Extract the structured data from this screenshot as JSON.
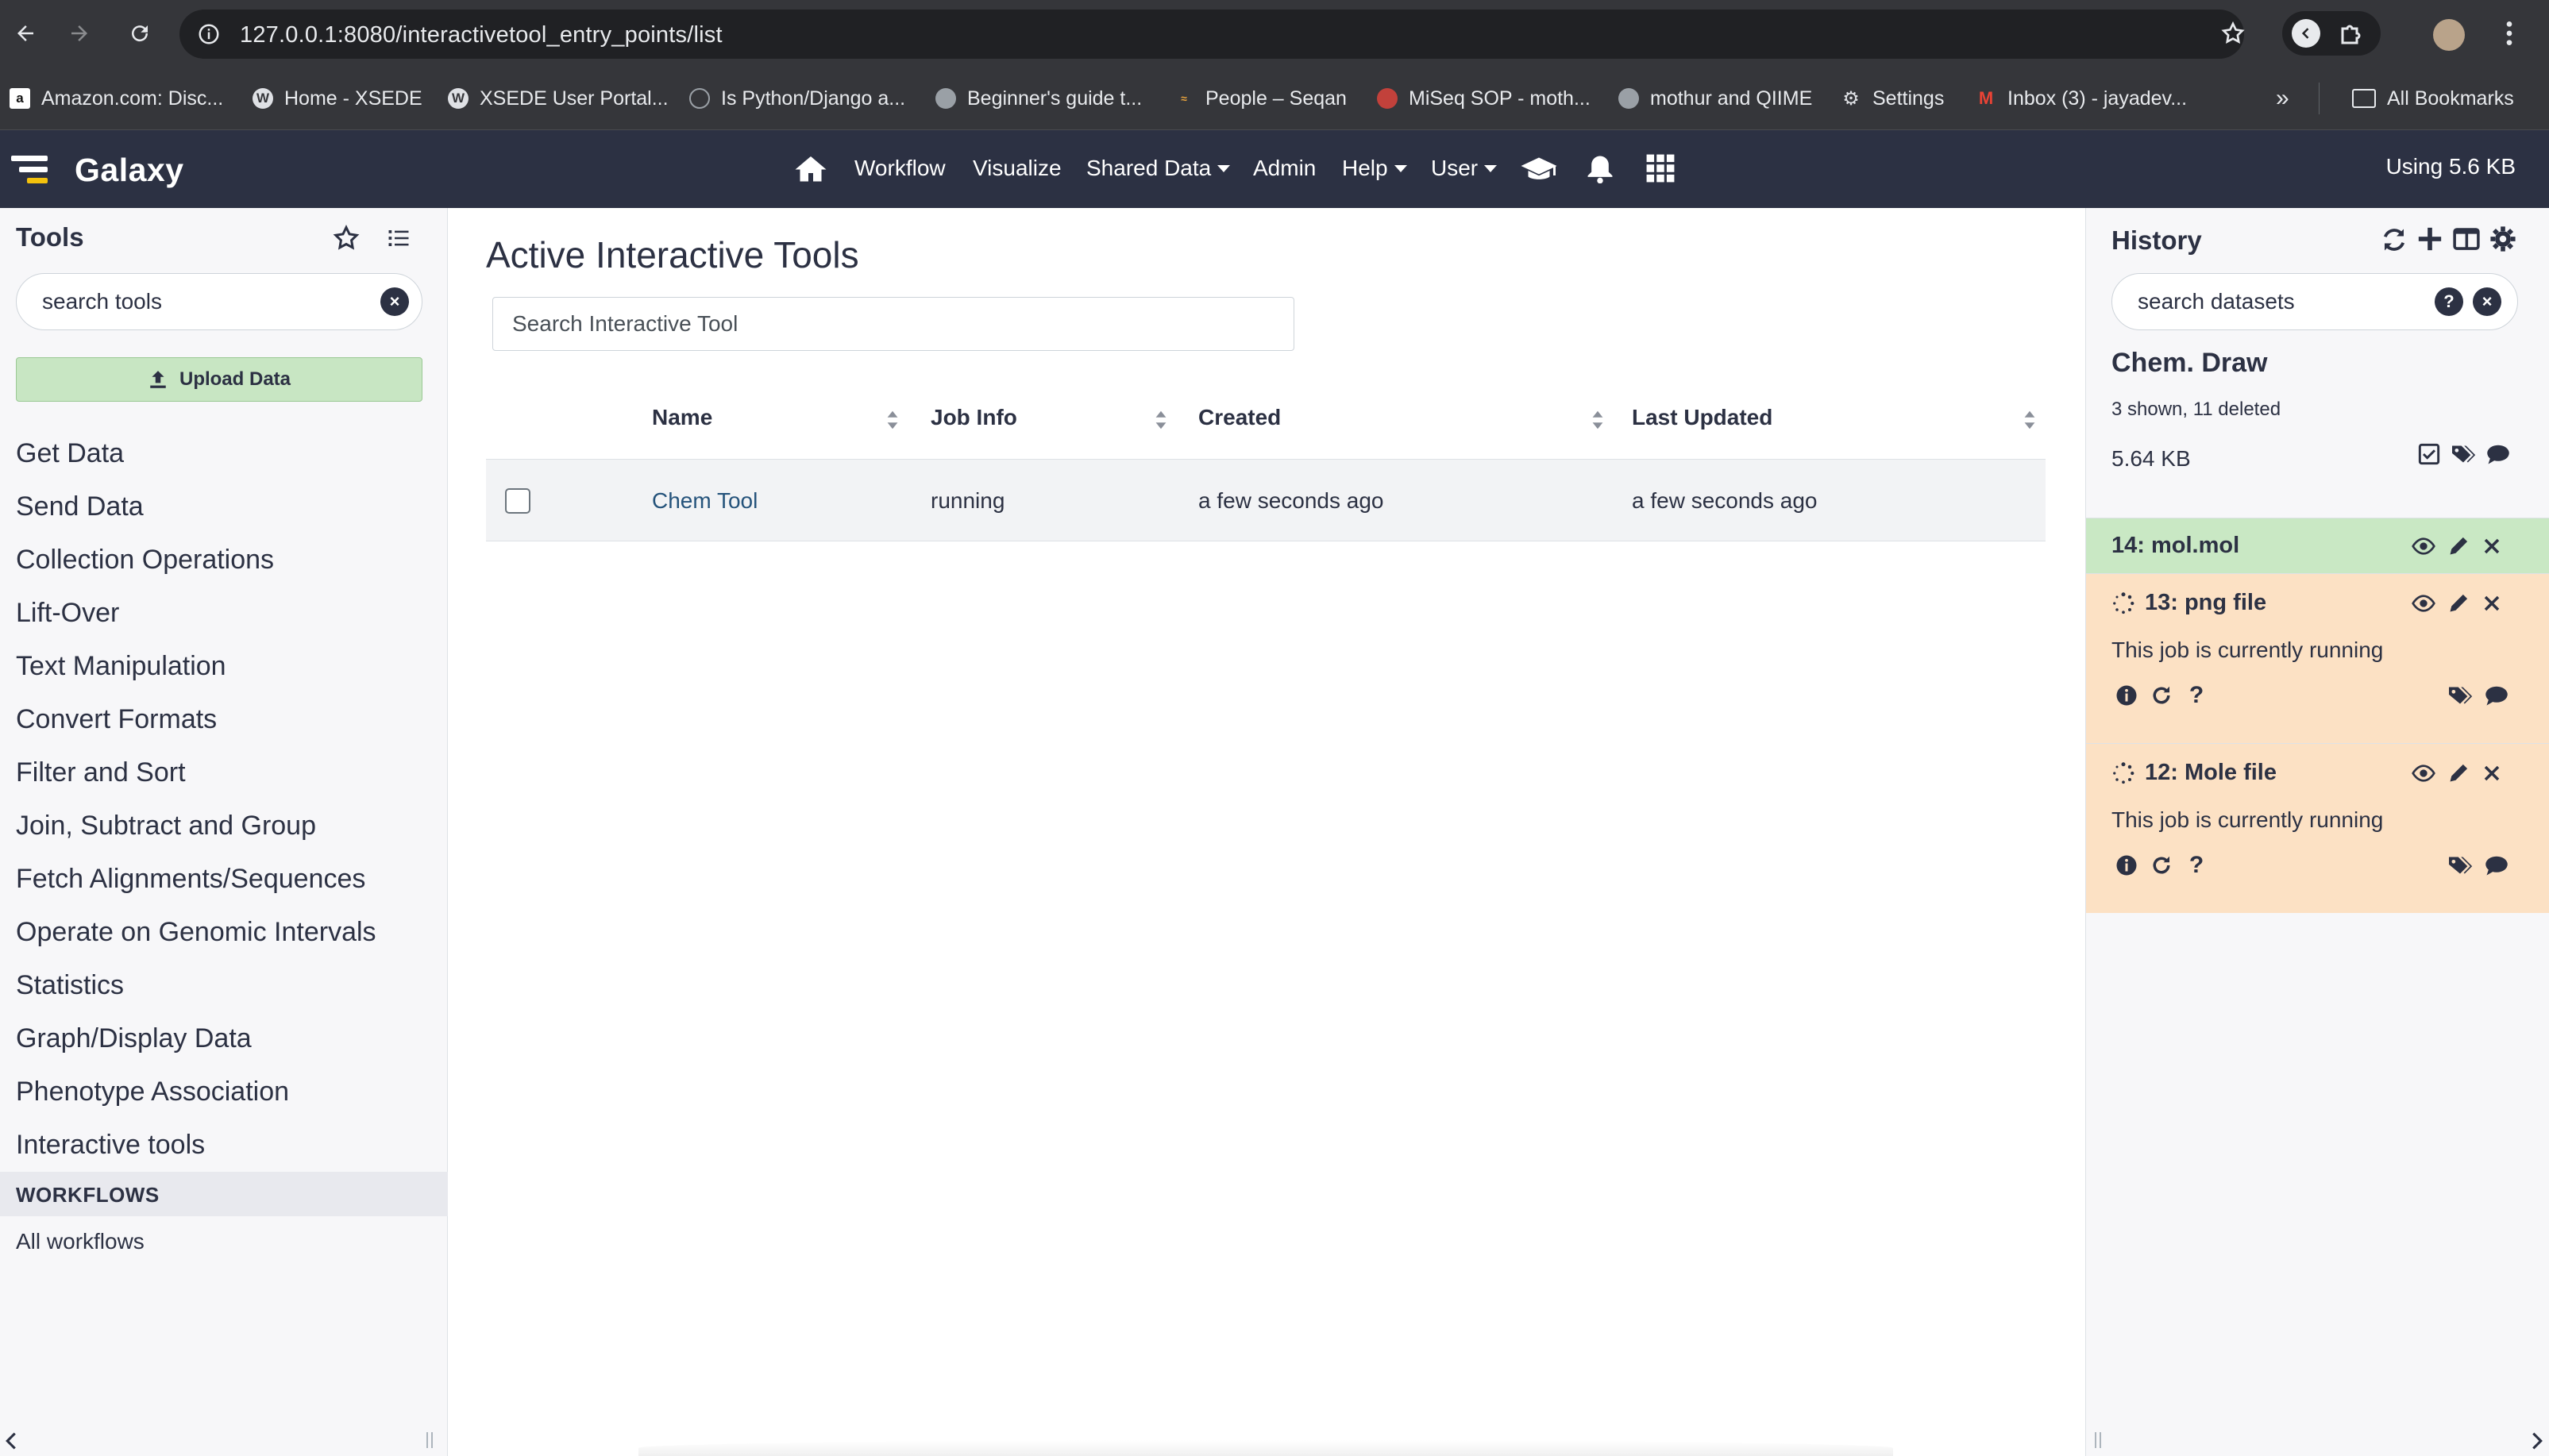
{
  "browser": {
    "url": "127.0.0.1:8080/interactivetool_entry_points/list",
    "bookmarks": [
      {
        "label": "Amazon.com: Disc...",
        "icon": "amazon-icon"
      },
      {
        "label": "Home - XSEDE",
        "icon": "wordpress-icon"
      },
      {
        "label": "XSEDE User Portal...",
        "icon": "wordpress-icon"
      },
      {
        "label": "Is Python/Django a...",
        "icon": "globe-icon"
      },
      {
        "label": "Beginner's guide t...",
        "icon": "globe-icon"
      },
      {
        "label": "People – Seqan",
        "icon": "seqan-icon"
      },
      {
        "label": "MiSeq SOP - moth...",
        "icon": "mothur-icon"
      },
      {
        "label": "mothur and QIIME",
        "icon": "globe-icon"
      },
      {
        "label": "Settings",
        "icon": "gear-icon"
      },
      {
        "label": "Inbox (3) - jayadev...",
        "icon": "gmail-icon"
      }
    ],
    "all_bookmarks": "All Bookmarks"
  },
  "masthead": {
    "brand": "Galaxy",
    "nav": {
      "workflow": "Workflow",
      "visualize": "Visualize",
      "shared_data": "Shared Data",
      "admin": "Admin",
      "help": "Help",
      "user": "User"
    },
    "quota": "Using 5.6 KB"
  },
  "tools": {
    "title": "Tools",
    "search_placeholder": "search tools",
    "upload_label": "Upload Data",
    "sections": [
      "Get Data",
      "Send Data",
      "Collection Operations",
      "Lift-Over",
      "Text Manipulation",
      "Convert Formats",
      "Filter and Sort",
      "Join, Subtract and Group",
      "Fetch Alignments/Sequences",
      "Operate on Genomic Intervals",
      "Statistics",
      "Graph/Display Data",
      "Phenotype Association",
      "Interactive tools"
    ],
    "workflows_heading": "WORKFLOWS",
    "all_workflows": "All workflows"
  },
  "center": {
    "title": "Active Interactive Tools",
    "search_placeholder": "Search Interactive Tool",
    "columns": {
      "name": "Name",
      "job_info": "Job Info",
      "created": "Created",
      "updated": "Last Updated"
    },
    "rows": [
      {
        "name": "Chem Tool",
        "job_info": "running",
        "created": "a few seconds ago",
        "updated": "a few seconds ago"
      }
    ]
  },
  "history": {
    "title": "History",
    "search_placeholder": "search datasets",
    "name": "Chem. Draw",
    "counts": "3 shown, 11 deleted",
    "size": "5.64 KB",
    "datasets": [
      {
        "title": "14: mol.mol",
        "state": "ok",
        "message": ""
      },
      {
        "title": "13: png file",
        "state": "running",
        "message": "This job is currently running"
      },
      {
        "title": "12: Mole file",
        "state": "running",
        "message": "This job is currently running"
      }
    ]
  },
  "colors": {
    "masthead": "#2c3143",
    "ok_dataset": "#c9e8c4",
    "running_dataset": "#fce1c4",
    "link": "#25537b"
  }
}
